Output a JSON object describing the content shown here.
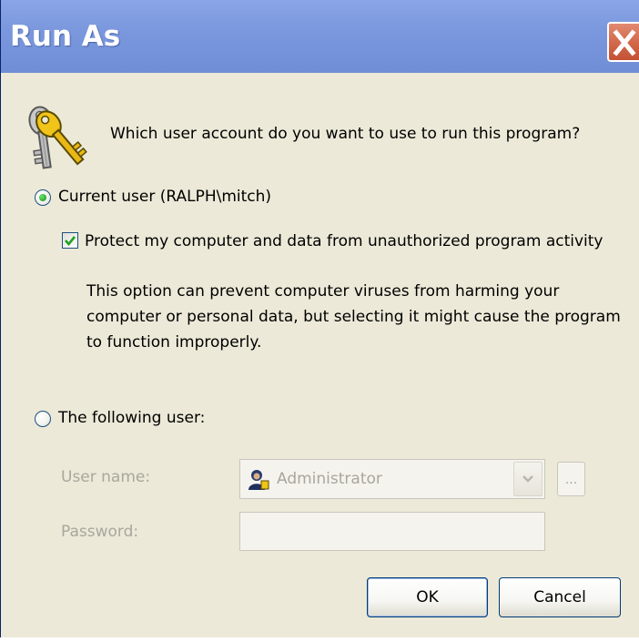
{
  "window": {
    "title": "Run As",
    "close_glyph": "✕"
  },
  "prompt": {
    "icon": "keys-icon",
    "text": "Which user account do you want to use to run this program?"
  },
  "current_user": {
    "label": "Current user (RALPH\\mitch)",
    "selected": true,
    "protect_checkbox": {
      "label": "Protect my computer and data from unauthorized program activity",
      "checked": true
    },
    "description_lines": [
      "This option can prevent computer viruses from harming your",
      "computer or personal data, but selecting it might cause the program",
      "to function improperly."
    ]
  },
  "following_user": {
    "label": "The following user:",
    "selected": false,
    "username_label": "User name:",
    "username_value": "Administrator",
    "username_icon": "user-icon",
    "browse_label": "...",
    "password_label": "Password:",
    "password_value": ""
  },
  "buttons": {
    "ok": "OK",
    "cancel": "Cancel"
  },
  "colors": {
    "titlebar": "#7b98de",
    "close": "#d26a4d",
    "dialog_bg": "#ece9d8",
    "radio_dot": "#2ea72e",
    "check_mark": "#21a121",
    "disabled_text": "#a9a79c"
  }
}
